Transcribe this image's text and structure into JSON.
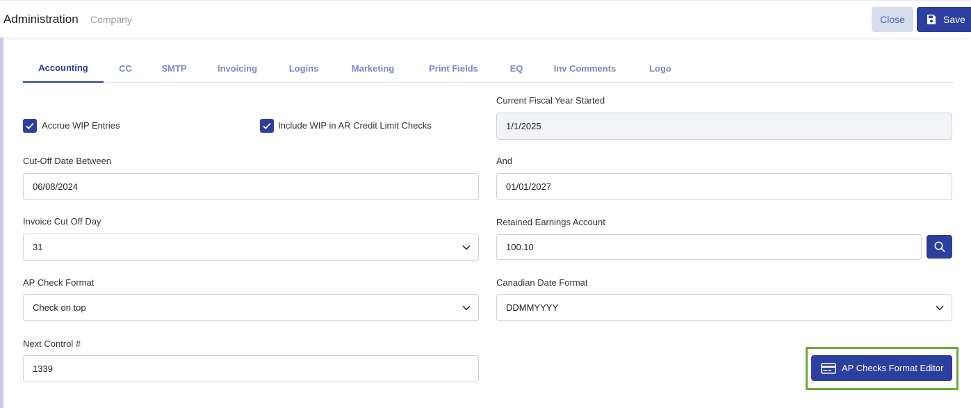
{
  "header": {
    "title": "Administration",
    "subtitle": "Company",
    "close_label": "Close",
    "save_label": "Save"
  },
  "tabs": [
    {
      "label": "Accounting",
      "active": true
    },
    {
      "label": "CC"
    },
    {
      "label": "SMTP"
    },
    {
      "label": "Invoicing"
    },
    {
      "label": "Logins"
    },
    {
      "label": "Marketing"
    },
    {
      "label": "Print Fields"
    },
    {
      "label": "EQ"
    },
    {
      "label": "Inv Comments"
    },
    {
      "label": "Logo"
    }
  ],
  "form": {
    "accrue_wip": {
      "label": "Accrue WIP Entries",
      "checked": true
    },
    "include_wip": {
      "label": "Include WIP in AR Credit Limit Checks",
      "checked": true
    },
    "fiscal_year": {
      "label": "Current Fiscal Year Started",
      "value": "1/1/2025"
    },
    "cutoff_from": {
      "label": "Cut-Off Date Between",
      "value": "06/08/2024"
    },
    "cutoff_to": {
      "label": "And",
      "value": "01/01/2027"
    },
    "invoice_cutoff": {
      "label": "Invoice Cut Off Day",
      "value": "31"
    },
    "retained_earnings": {
      "label": "Retained Earnings Account",
      "value": "100.10"
    },
    "ap_check_format": {
      "label": "AP Check Format",
      "value": "Check on top"
    },
    "canadian_date": {
      "label": "Canadian Date Format",
      "value": "DDMMYYYY"
    },
    "next_control": {
      "label": "Next Control #",
      "value": "1339"
    }
  },
  "ap_checks_button": {
    "label": "AP Checks Format Editor",
    "icon": "credit-card-icon"
  },
  "colors": {
    "primary": "#2c3e9e",
    "highlight": "#6aaa3a",
    "tab_inactive": "#7d88c7"
  }
}
